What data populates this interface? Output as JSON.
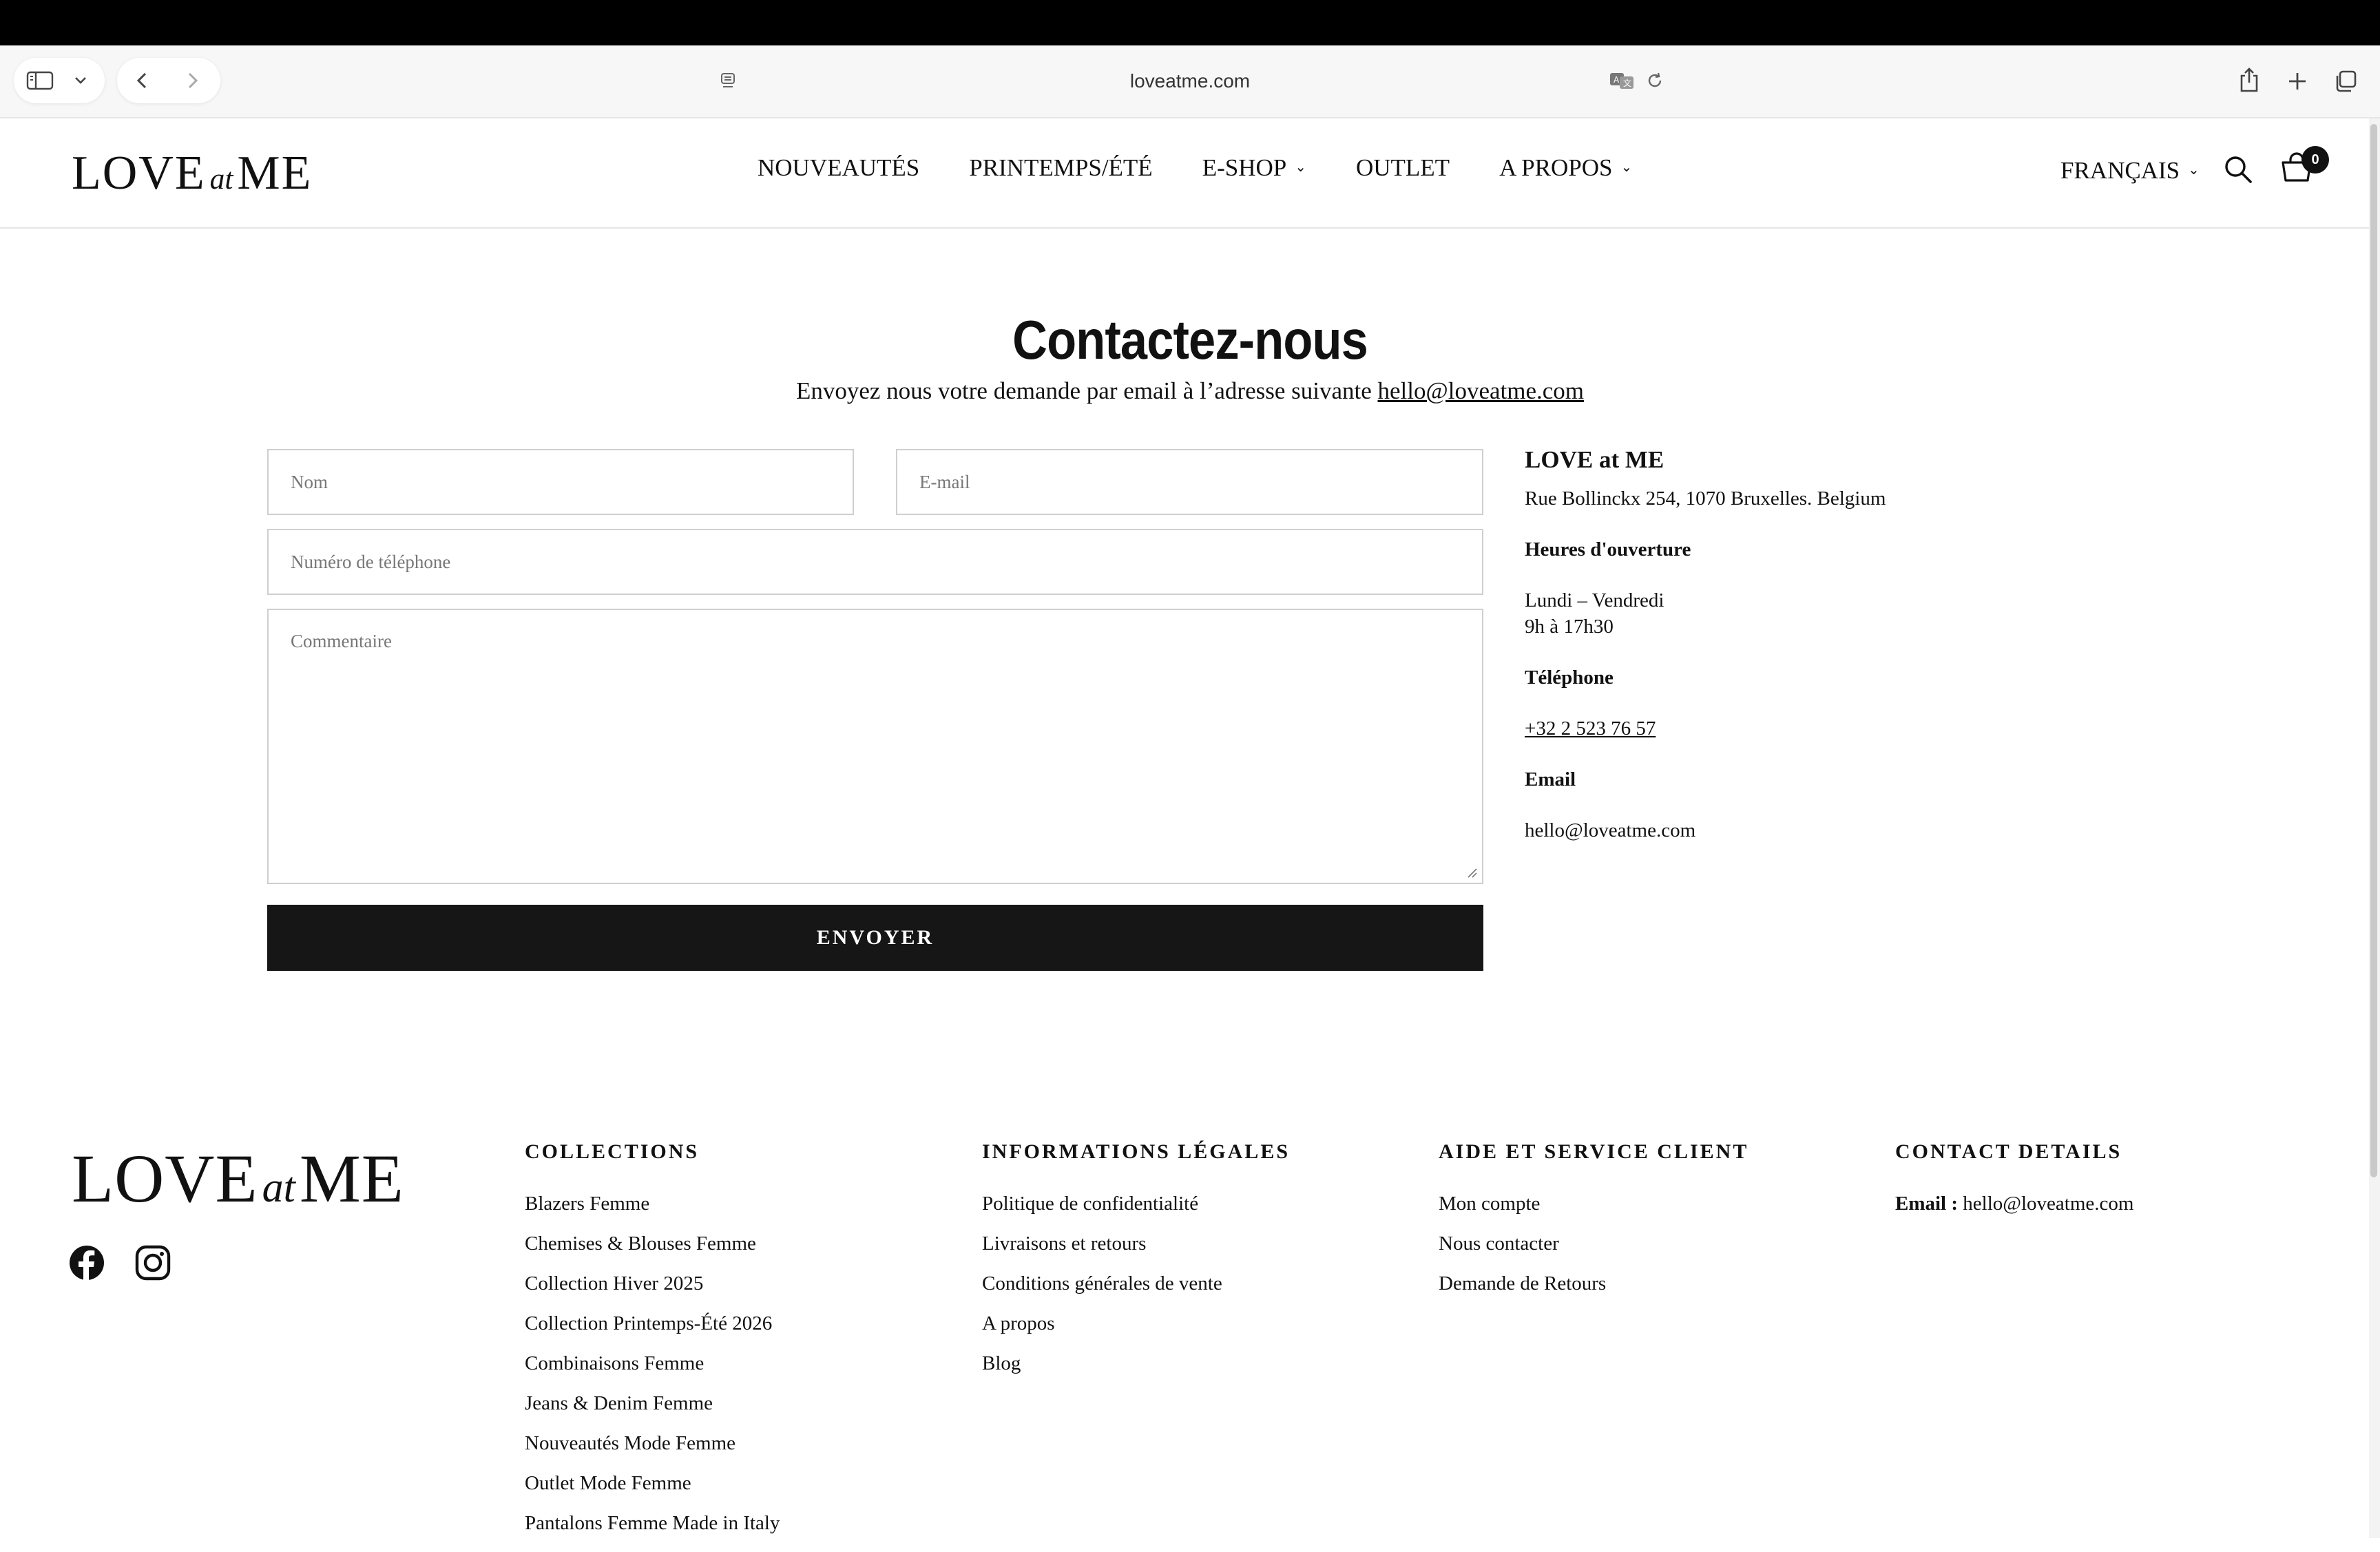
{
  "browser": {
    "url": "loveatme.com"
  },
  "header": {
    "logo": {
      "part1": "LOVE",
      "part2": "at",
      "part3": "ME"
    },
    "nav": [
      {
        "label": "NOUVEAUTÉS",
        "dropdown": false
      },
      {
        "label": "PRINTEMPS/ÉTÉ",
        "dropdown": false
      },
      {
        "label": "E-SHOP",
        "dropdown": true
      },
      {
        "label": "OUTLET",
        "dropdown": false
      },
      {
        "label": "A PROPOS",
        "dropdown": true
      }
    ],
    "language": "FRANÇAIS",
    "cart_count": "0"
  },
  "contact": {
    "title": "Contactez-nous",
    "subtitle": "Envoyez nous votre demande par email à l’adresse suivante ",
    "subtitle_email": "hello@loveatme.com",
    "form": {
      "name_placeholder": "Nom",
      "email_placeholder": "E-mail",
      "phone_placeholder": "Numéro de téléphone",
      "comment_placeholder": "Commentaire",
      "submit_label": "ENVOYER"
    },
    "info": {
      "name": "LOVE at ME",
      "address": "Rue Bollinckx 254, 1070 Bruxelles. Belgium",
      "hours_heading": "Heures d'ouverture",
      "hours_days": "Lundi – Vendredi",
      "hours_time": "9h à 17h30",
      "phone_heading": "Téléphone",
      "phone": "+32 2 523 76 57",
      "email_heading": "Email",
      "email": "hello@loveatme.com"
    }
  },
  "footer": {
    "logo": {
      "part1": "LOVE",
      "part2": "at",
      "part3": "ME"
    },
    "social": [
      "facebook-icon",
      "instagram-icon"
    ],
    "collections": {
      "heading": "COLLECTIONS",
      "links": [
        "Blazers Femme",
        "Chemises & Blouses Femme",
        "Collection Hiver 2025",
        "Collection Printemps-Été 2026",
        "Combinaisons Femme",
        "Jeans & Denim Femme",
        "Nouveautés Mode Femme",
        "Outlet Mode Femme",
        "Pantalons Femme Made in Italy"
      ]
    },
    "legal": {
      "heading": "INFORMATIONS LÉGALES",
      "links": [
        "Politique de confidentialité",
        "Livraisons et retours",
        "Conditions générales de vente",
        "A propos",
        "Blog"
      ]
    },
    "help": {
      "heading": "AIDE ET SERVICE CLIENT",
      "links": [
        "Mon compte",
        "Nous contacter",
        "Demande de Retours"
      ]
    },
    "contact": {
      "heading": "CONTACT DETAILS",
      "email_label": "Email :",
      "email": "hello@loveatme.com"
    }
  }
}
